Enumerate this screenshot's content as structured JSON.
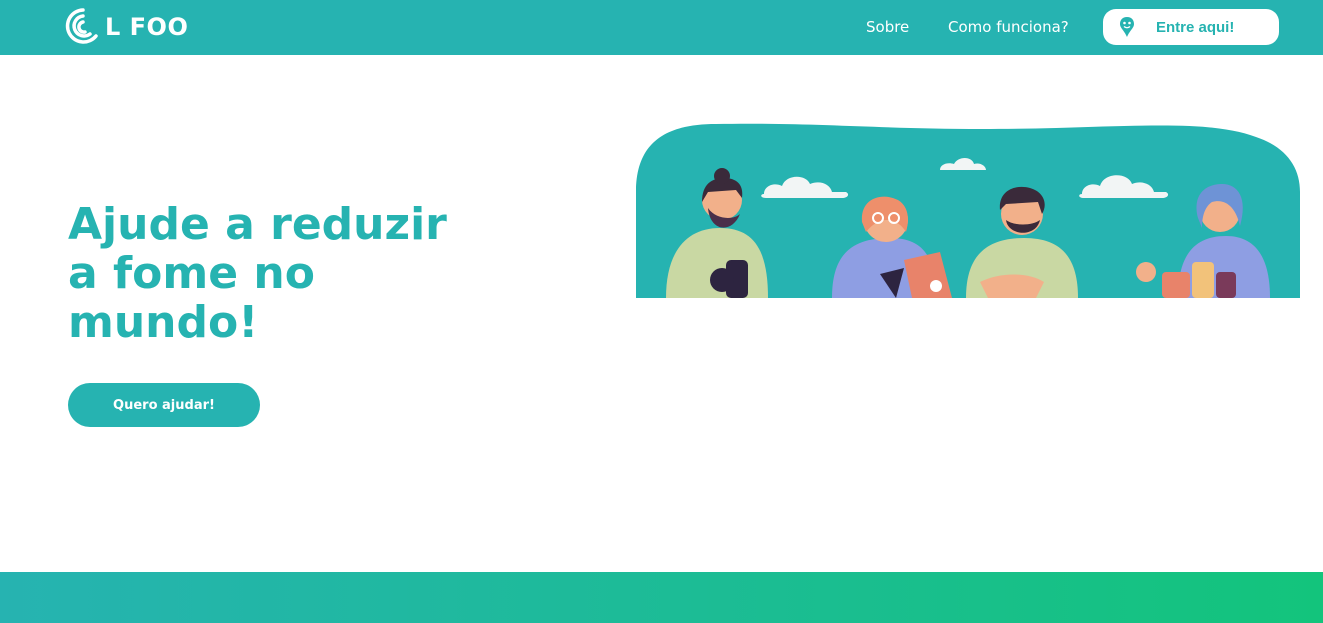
{
  "header": {
    "logo_text": "L FOO",
    "logo_icon": "leaf-circle-logo-icon",
    "nav": [
      {
        "label": "Sobre"
      },
      {
        "label": "Como funciona?"
      }
    ],
    "login": {
      "label": "Entre aqui!",
      "icon": "pin-person-icon"
    }
  },
  "hero": {
    "title": "Ajude a reduzir a fome no mundo!",
    "cta_label": "Quero ajudar!"
  },
  "colors": {
    "primary": "#26b3b1",
    "accent_green": "#13c47c",
    "white": "#ffffff"
  }
}
